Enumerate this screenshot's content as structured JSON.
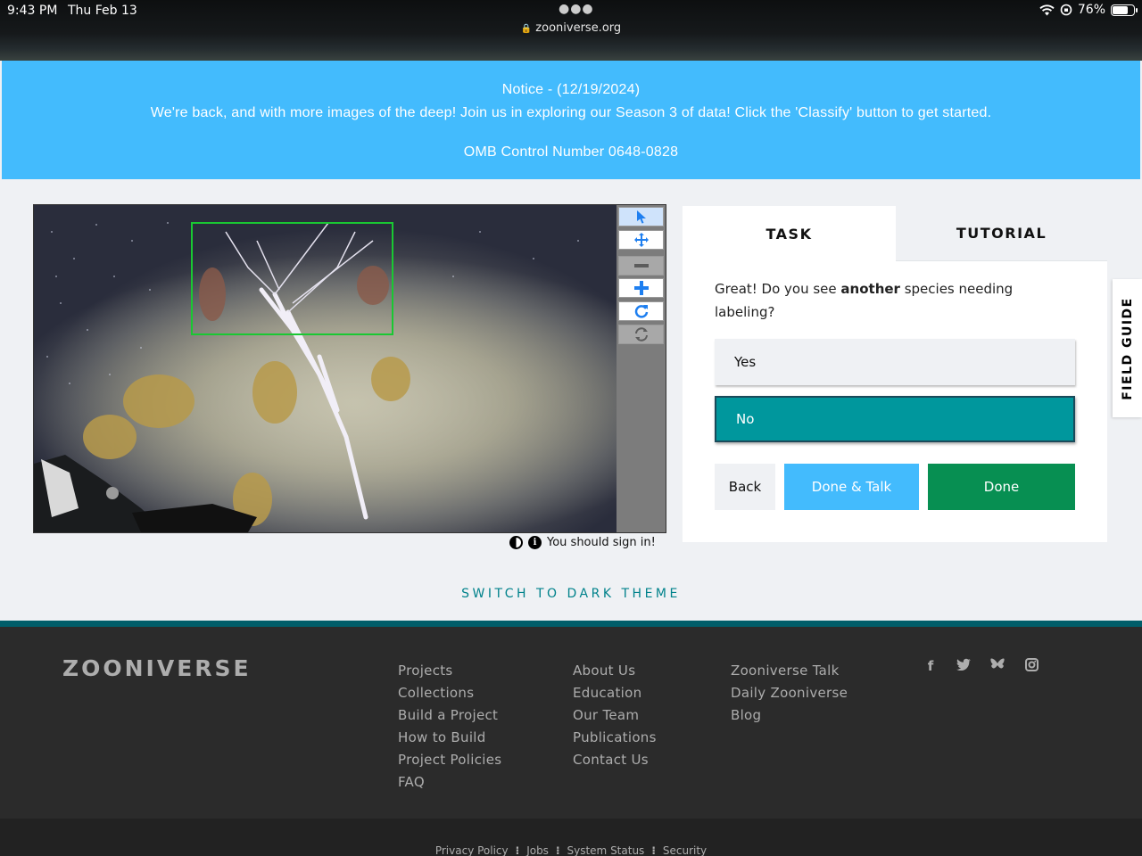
{
  "status_bar": {
    "time": "9:43 PM",
    "date": "Thu Feb 13",
    "url": "zooniverse.org",
    "battery": "76%",
    "battery_level": 0.76
  },
  "notice": {
    "title": "Notice - (12/19/2024)",
    "message": "We're back, and with more images of the deep! Join us in exploring our Season 3 of data! Click the 'Classify' button to get started.",
    "omb": "OMB Control Number 0648-0828"
  },
  "viewer": {
    "tools": [
      "pointer-icon",
      "move-icon",
      "zoom-out-icon",
      "zoom-in-icon",
      "rotate-icon",
      "reset-icon"
    ],
    "signin_text": "You should sign in!"
  },
  "task": {
    "tab_task": "TASK",
    "tab_tutorial": "TUTORIAL",
    "question_before": "Great! Do you see ",
    "question_bold": "another",
    "question_after": " species needing labeling?",
    "answer_yes": "Yes",
    "answer_no": "No",
    "selected_answer": "No",
    "back": "Back",
    "done_talk": "Done & Talk",
    "done": "Done"
  },
  "field_guide": "FIELD GUIDE",
  "dark_theme": "SWITCH TO DARK THEME",
  "footer": {
    "logo": "ZOONIVERSE",
    "col1": [
      "Projects",
      "Collections",
      "Build a Project",
      "How to Build",
      "Project Policies",
      "FAQ"
    ],
    "col2": [
      "About Us",
      "Education",
      "Our Team",
      "Publications",
      "Contact Us"
    ],
    "col3": [
      "Zooniverse Talk",
      "Daily Zooniverse",
      "Blog"
    ],
    "social": [
      "facebook-icon",
      "twitter-icon",
      "bluesky-icon",
      "instagram-icon"
    ],
    "legal": [
      "Privacy Policy",
      "Jobs",
      "System Status",
      "Security"
    ]
  },
  "colors": {
    "notice_bg": "#43bbfd",
    "selected_answer": "#00979d",
    "done_button": "#078f52",
    "talk_button": "#43bbfd",
    "footer_bg": "#2b2b2b",
    "accent_teal": "#00828b",
    "bbox": "#19c832"
  }
}
